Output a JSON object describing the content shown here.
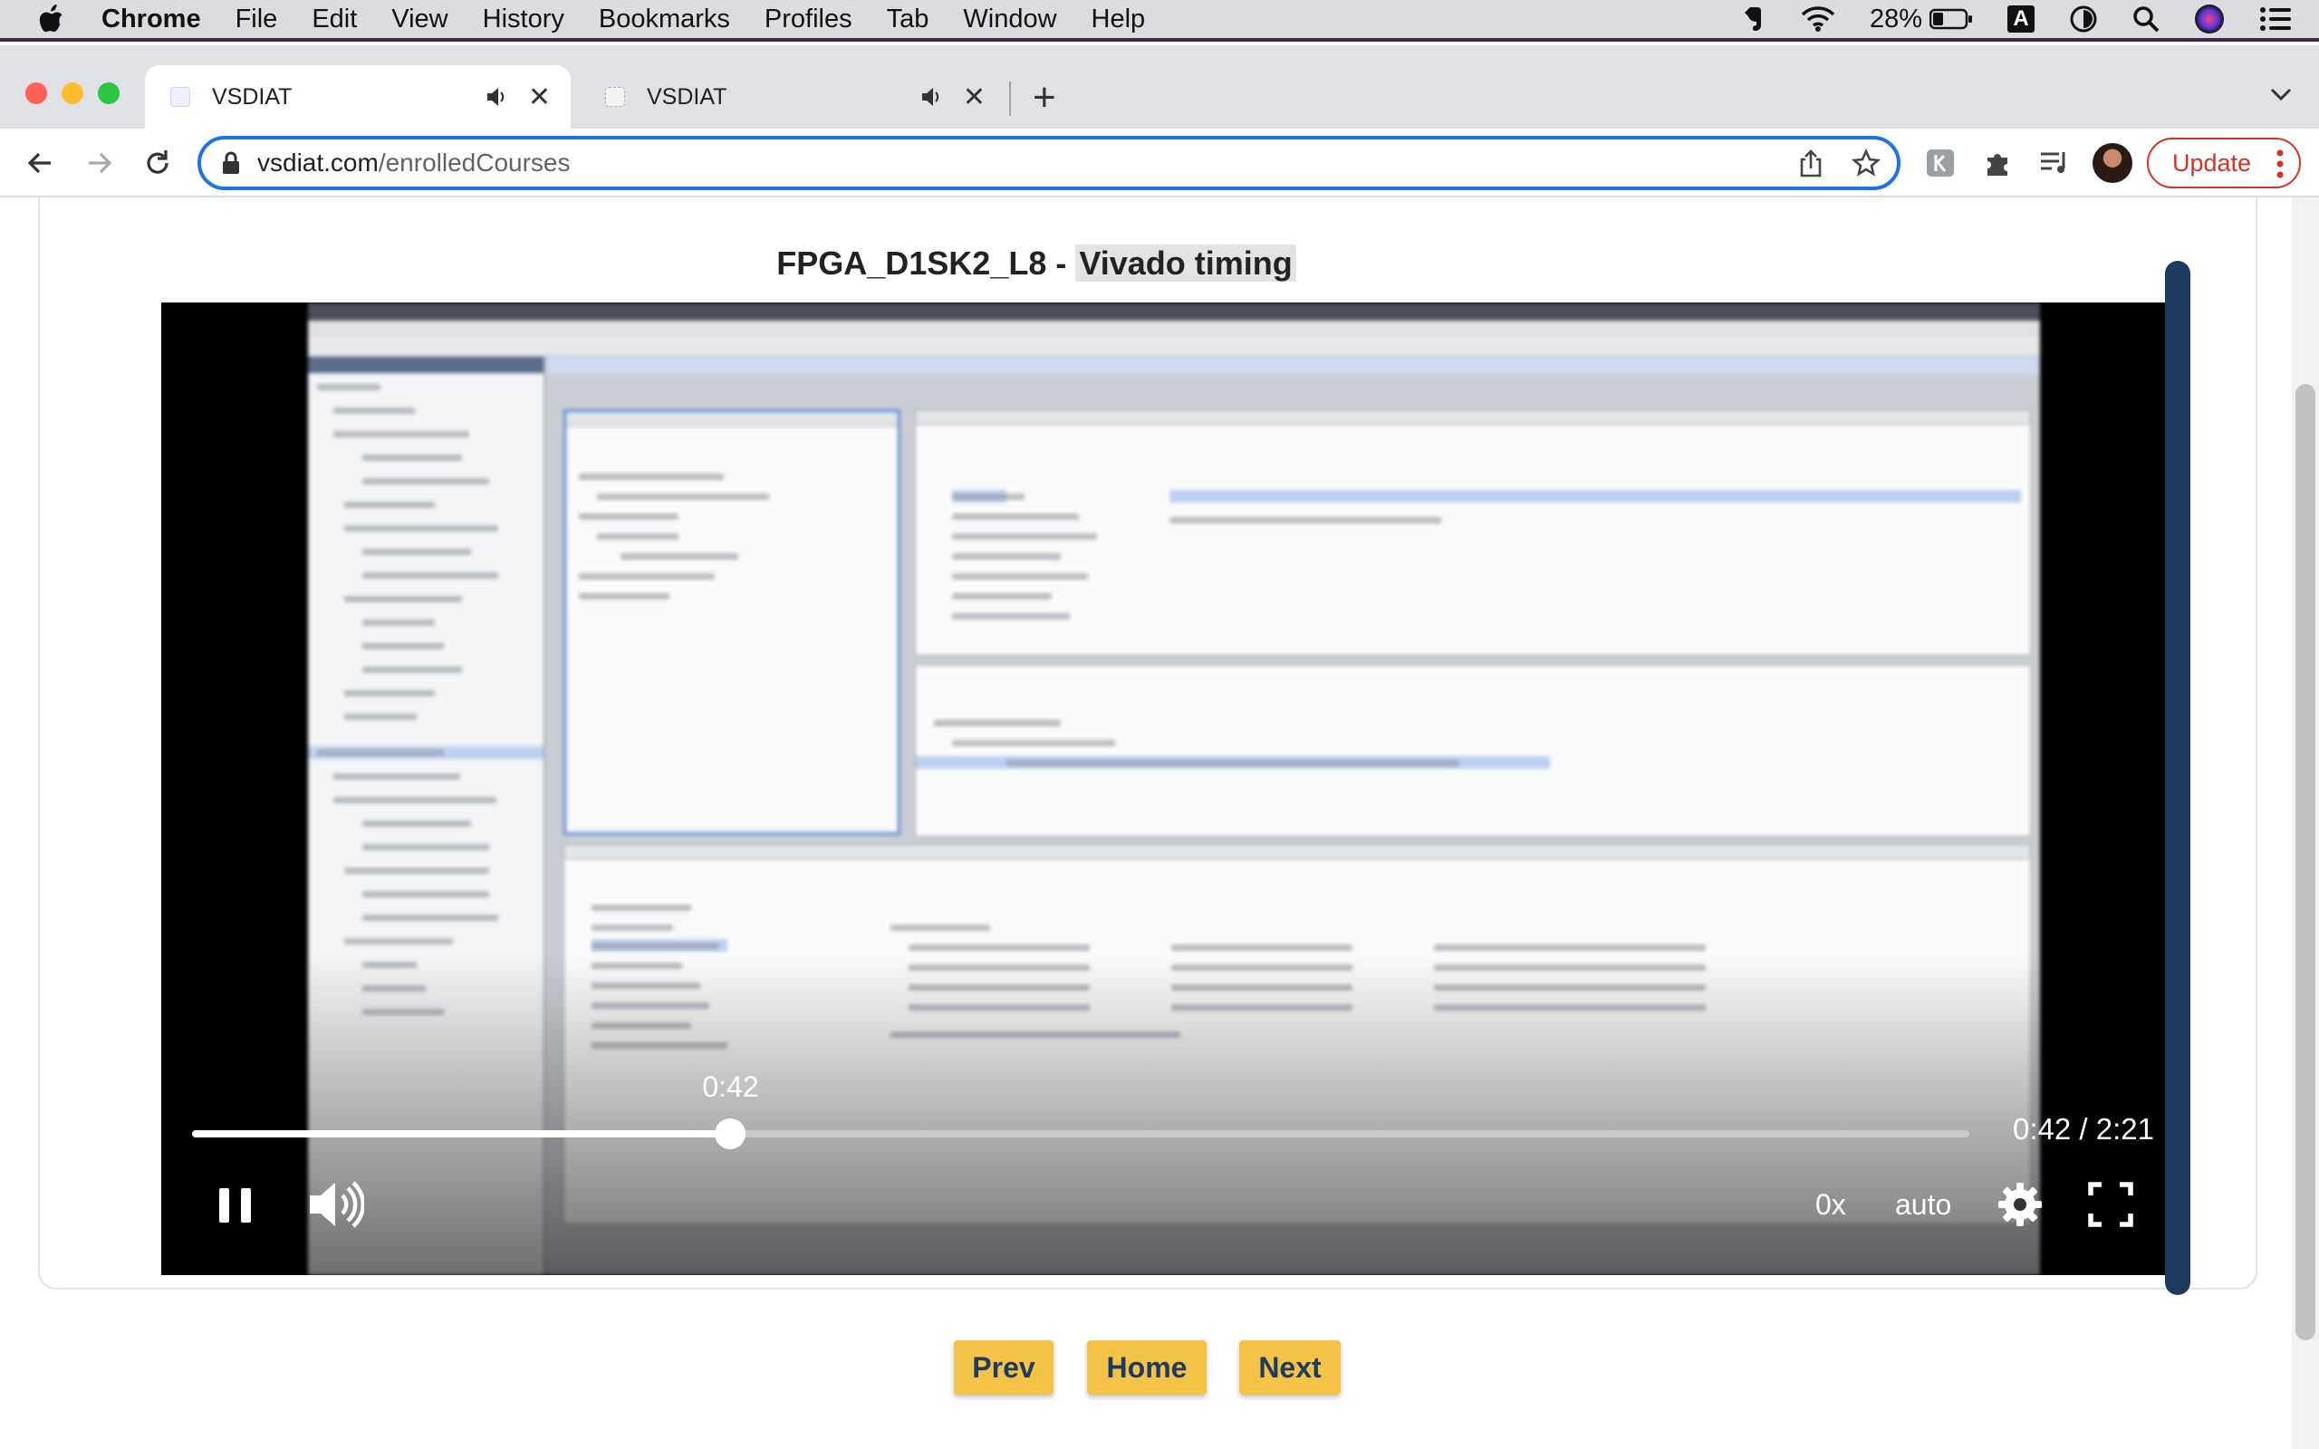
{
  "menubar": {
    "app": "Chrome",
    "items": [
      "File",
      "Edit",
      "View",
      "History",
      "Bookmarks",
      "Profiles",
      "Tab",
      "Window",
      "Help"
    ],
    "battery": "28%",
    "input_source": "A"
  },
  "tabs": [
    {
      "title": "VSDIAT",
      "active": true
    },
    {
      "title": "VSDIAT",
      "active": false
    }
  ],
  "toolbar": {
    "url_host": "vsdiat.com",
    "url_path": "/enrolledCourses",
    "update_label": "Update"
  },
  "lesson": {
    "title_prefix": "FPGA_D1SK2_L8 - ",
    "title_highlight": "Vivado timing"
  },
  "video": {
    "hover_time": "0:42",
    "time_display": "0:42 / 2:21",
    "progress": 0.303,
    "speed_label": "0x",
    "quality_label": "auto",
    "playing": true
  },
  "nav": {
    "prev": "Prev",
    "home": "Home",
    "next": "Next"
  },
  "colors": {
    "accent_blue": "#1a73e8",
    "update_red": "#d93025",
    "nav_button": "#f4c247",
    "nav_text": "#1e3a5f",
    "rail": "#1e3a5f"
  }
}
